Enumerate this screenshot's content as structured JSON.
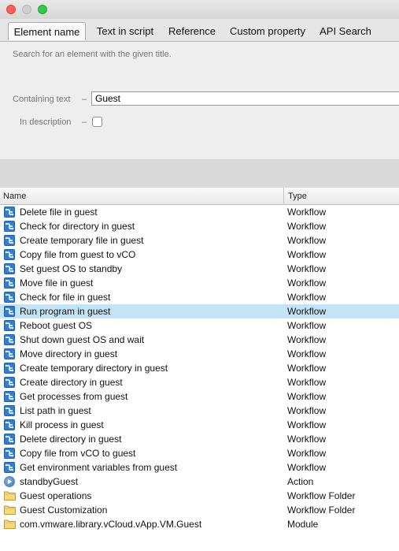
{
  "tabs": [
    {
      "label": "Element name",
      "active": true
    },
    {
      "label": "Text in script",
      "active": false
    },
    {
      "label": "Reference",
      "active": false
    },
    {
      "label": "Custom property",
      "active": false
    },
    {
      "label": "API Search",
      "active": false
    }
  ],
  "search": {
    "hint": "Search for an element with the given title.",
    "containing_label": "Containing text",
    "dash": "–",
    "containing_value": "Guest",
    "description_label": "In description",
    "description_checked": false
  },
  "table": {
    "col_name": "Name",
    "col_type": "Type",
    "selected_row": 7,
    "rows": [
      {
        "name": "Delete file in guest",
        "type": "Workflow",
        "icon": "workflow-icon"
      },
      {
        "name": "Check for directory in guest",
        "type": "Workflow",
        "icon": "workflow-icon"
      },
      {
        "name": "Create temporary file in guest",
        "type": "Workflow",
        "icon": "workflow-icon"
      },
      {
        "name": "Copy file from guest to vCO",
        "type": "Workflow",
        "icon": "workflow-icon"
      },
      {
        "name": "Set guest OS to standby",
        "type": "Workflow",
        "icon": "workflow-icon"
      },
      {
        "name": "Move file in guest",
        "type": "Workflow",
        "icon": "workflow-icon"
      },
      {
        "name": "Check for file in guest",
        "type": "Workflow",
        "icon": "workflow-icon"
      },
      {
        "name": "Run program in guest",
        "type": "Workflow",
        "icon": "workflow-icon"
      },
      {
        "name": "Reboot guest OS",
        "type": "Workflow",
        "icon": "workflow-icon"
      },
      {
        "name": "Shut down guest OS and wait",
        "type": "Workflow",
        "icon": "workflow-icon"
      },
      {
        "name": "Move directory in guest",
        "type": "Workflow",
        "icon": "workflow-icon"
      },
      {
        "name": "Create temporary directory in guest",
        "type": "Workflow",
        "icon": "workflow-icon"
      },
      {
        "name": "Create directory in guest",
        "type": "Workflow",
        "icon": "workflow-icon"
      },
      {
        "name": "Get processes from guest",
        "type": "Workflow",
        "icon": "workflow-icon"
      },
      {
        "name": "List path in guest",
        "type": "Workflow",
        "icon": "workflow-icon"
      },
      {
        "name": "Kill process in guest",
        "type": "Workflow",
        "icon": "workflow-icon"
      },
      {
        "name": "Delete directory in guest",
        "type": "Workflow",
        "icon": "workflow-icon"
      },
      {
        "name": "Copy file from vCO to guest",
        "type": "Workflow",
        "icon": "workflow-icon"
      },
      {
        "name": "Get environment variables from guest",
        "type": "Workflow",
        "icon": "workflow-icon"
      },
      {
        "name": "standbyGuest",
        "type": "Action",
        "icon": "action-icon"
      },
      {
        "name": "Guest operations",
        "type": "Workflow Folder",
        "icon": "folder-icon"
      },
      {
        "name": "Guest Customization",
        "type": "Workflow Folder",
        "icon": "folder-icon"
      },
      {
        "name": "com.vmware.library.vCloud.vApp.VM.Guest",
        "type": "Module",
        "icon": "folder-icon"
      }
    ]
  }
}
